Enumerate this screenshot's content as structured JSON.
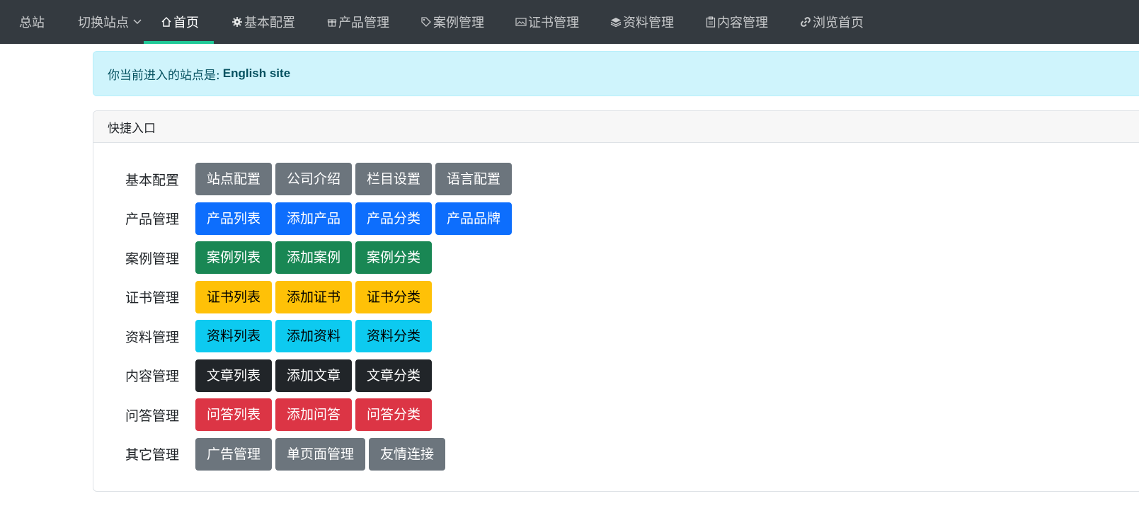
{
  "nav": {
    "brand": "总站",
    "switch_site": "切换站点",
    "items": [
      {
        "label": "首页",
        "icon": "house-icon",
        "active": true
      },
      {
        "label": "基本配置",
        "icon": "gear-icon"
      },
      {
        "label": "产品管理",
        "icon": "gift-icon"
      },
      {
        "label": "案例管理",
        "icon": "tag-icon"
      },
      {
        "label": "证书管理",
        "icon": "image-icon"
      },
      {
        "label": "资料管理",
        "icon": "layers-icon"
      },
      {
        "label": "内容管理",
        "icon": "clipboard-icon"
      },
      {
        "label": "浏览首页",
        "icon": "link-icon"
      }
    ],
    "active_color": "#20c997"
  },
  "alert": {
    "prefix": "你当前进入的站点是:",
    "site_name": "English site"
  },
  "quick": {
    "title": "快捷入口",
    "rows": [
      {
        "label": "基本配置",
        "style": "secondary",
        "buttons": [
          "站点配置",
          "公司介绍",
          "栏目设置",
          "语言配置"
        ]
      },
      {
        "label": "产品管理",
        "style": "primary",
        "buttons": [
          "产品列表",
          "添加产品",
          "产品分类",
          "产品品牌"
        ]
      },
      {
        "label": "案例管理",
        "style": "success",
        "buttons": [
          "案例列表",
          "添加案例",
          "案例分类"
        ]
      },
      {
        "label": "证书管理",
        "style": "warning",
        "buttons": [
          "证书列表",
          "添加证书",
          "证书分类"
        ]
      },
      {
        "label": "资料管理",
        "style": "info",
        "buttons": [
          "资料列表",
          "添加资料",
          "资料分类"
        ]
      },
      {
        "label": "内容管理",
        "style": "dark",
        "buttons": [
          "文章列表",
          "添加文章",
          "文章分类"
        ]
      },
      {
        "label": "问答管理",
        "style": "danger",
        "buttons": [
          "问答列表",
          "添加问答",
          "问答分类"
        ]
      },
      {
        "label": "其它管理",
        "style": "secondary",
        "buttons": [
          "广告管理",
          "单页面管理",
          "友情连接"
        ]
      }
    ]
  }
}
